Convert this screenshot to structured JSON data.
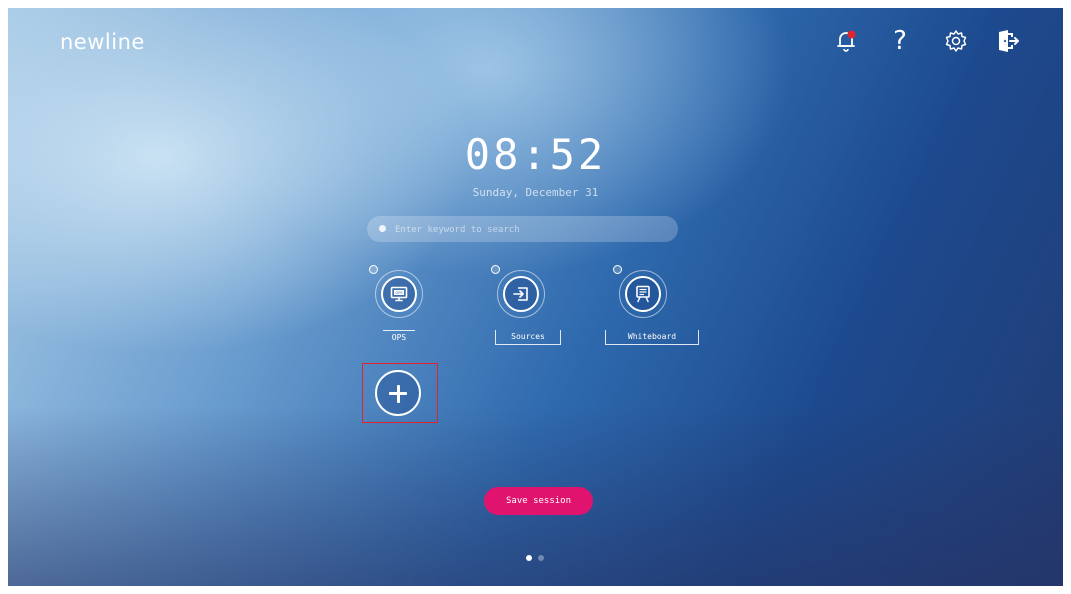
{
  "brand": {
    "logo_text": "newline"
  },
  "topbar": {
    "icons": [
      "notification-bell-icon",
      "help-icon",
      "settings-gear-icon",
      "exit-icon"
    ],
    "help_glyph": "?",
    "notification_badge_color": "#e0242f"
  },
  "clock": {
    "time": "08:52",
    "date": "Sunday, December 31"
  },
  "search": {
    "placeholder": "Enter keyword to search",
    "value": ""
  },
  "apps": [
    {
      "label": "OPS",
      "icon": "monitor-icon",
      "screen_text": "OPS"
    },
    {
      "label": "Sources",
      "icon": "input-source-icon"
    },
    {
      "label": "Whiteboard",
      "icon": "whiteboard-icon"
    }
  ],
  "add_button": {
    "icon": "plus-icon",
    "highlight_color": "#e0242f"
  },
  "session": {
    "save_label": "Save session"
  },
  "pager": {
    "pages": 2,
    "current": 1
  },
  "colors": {
    "accent_pink": "#e0146e",
    "background_top": "#a9cbe6",
    "background_bottom": "#223b73"
  }
}
